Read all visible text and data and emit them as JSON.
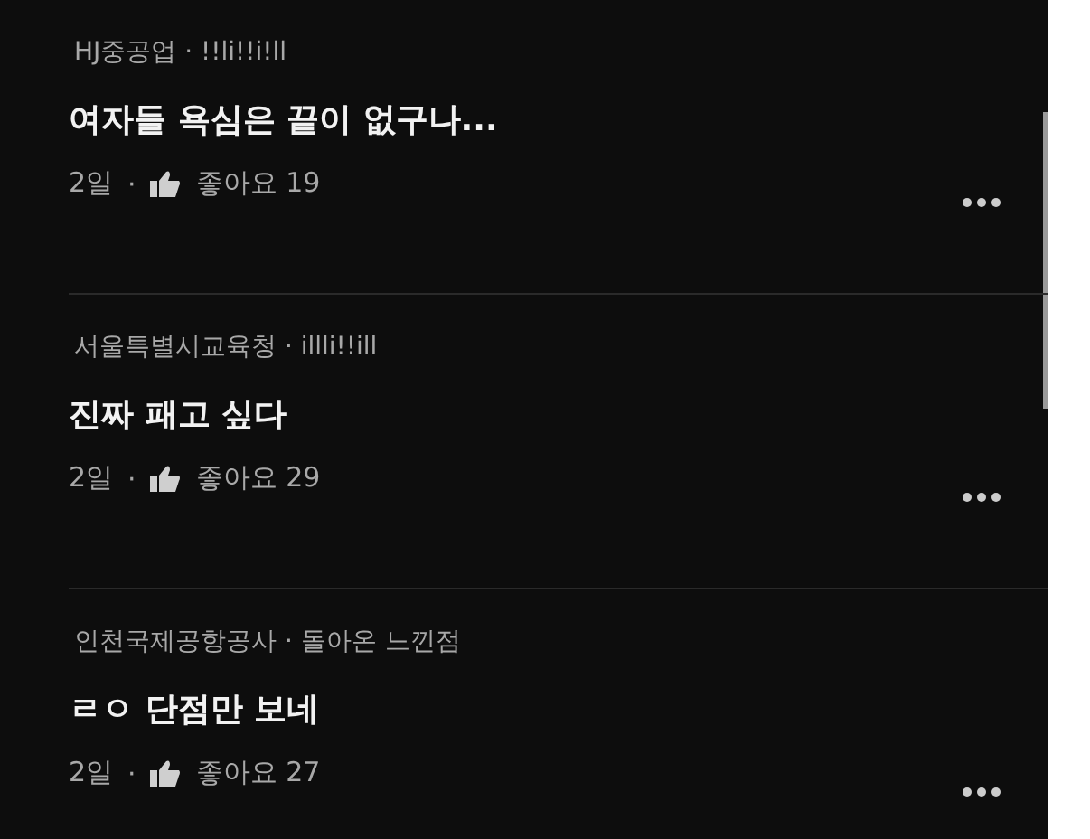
{
  "comments": [
    {
      "author": "HJ중공업 · !!li!!i!ll",
      "text": "여자들 욕심은 끝이 없구나...",
      "time": "2일",
      "separator": "·",
      "likes": "좋아요 19"
    },
    {
      "author": "서울특별시교육청 · illli!!ill",
      "text": "진짜 패고 싶다",
      "time": "2일",
      "separator": "·",
      "likes": "좋아요 29"
    },
    {
      "author": "인천국제공항공사 · 돌아온 느낀점",
      "text": "ㄹㅇ 단점만 보네",
      "time": "2일",
      "separator": "·",
      "likes": "좋아요 27"
    }
  ]
}
